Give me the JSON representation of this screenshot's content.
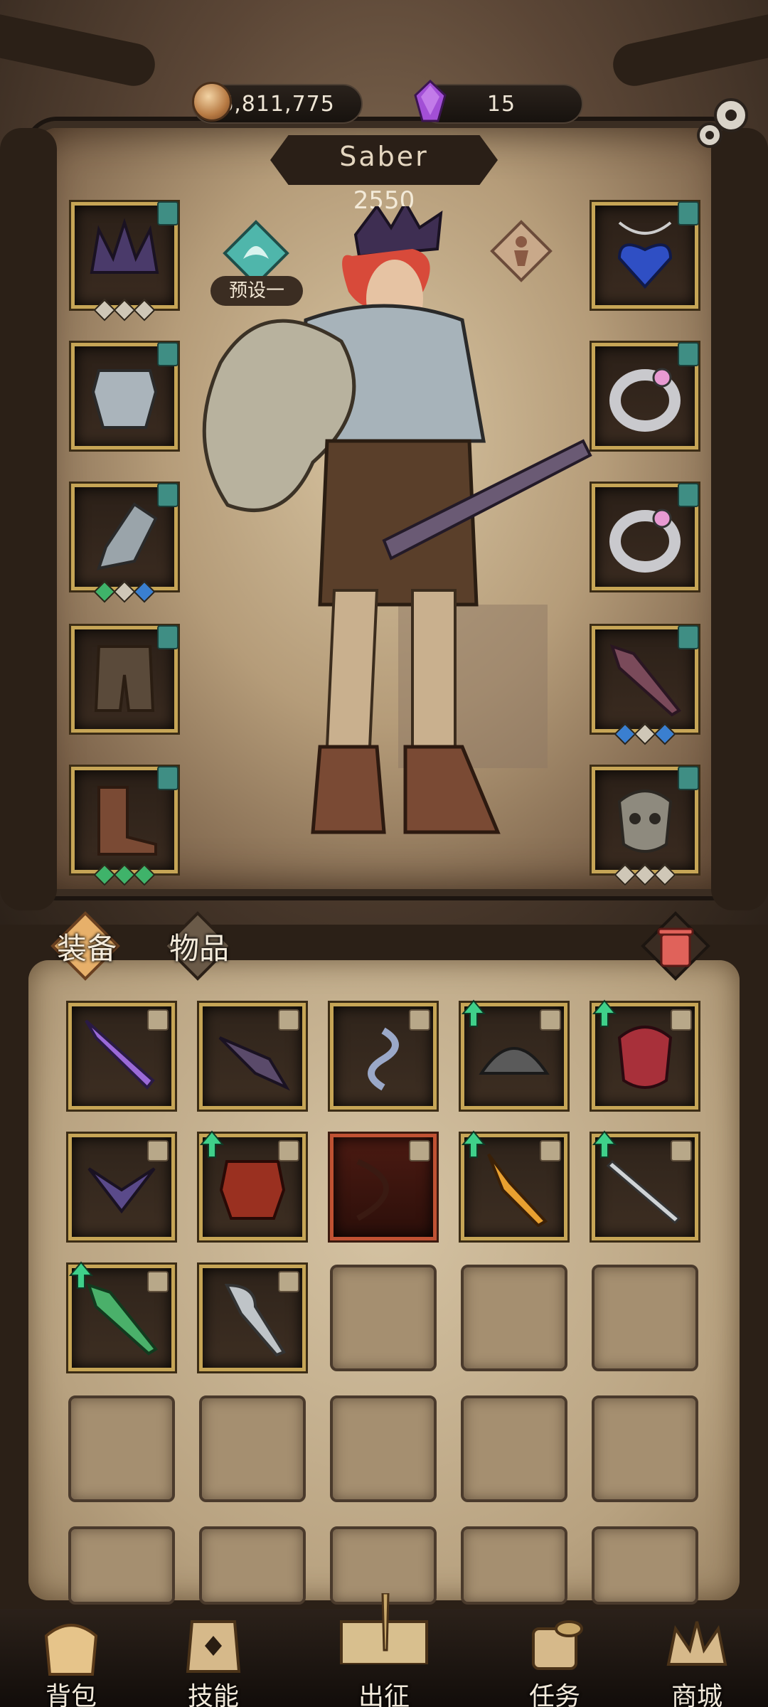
{
  "currency": {
    "gold": "6,811,775",
    "gems": "15"
  },
  "hero": {
    "name": "Saber",
    "power": "2550",
    "preset_label": "预设一"
  },
  "equipment": {
    "left_slots": [
      "crown-icon",
      "chest-armor-icon",
      "gauntlet-icon",
      "pants-icon",
      "boots-icon"
    ],
    "right_slots": [
      "heart-necklace-icon",
      "ring-icon",
      "ring-icon",
      "spiked-club-icon",
      "skull-shield-icon"
    ]
  },
  "inventory": {
    "tabs": [
      {
        "label": "装备"
      },
      {
        "label": "物品"
      }
    ],
    "items": [
      "purple-dagger-icon",
      "dark-blade-icon",
      "serpent-amulet-icon",
      "feathered-hat-icon",
      "red-mask-icon",
      "winged-crown-icon",
      "red-armor-icon",
      "dark-bow-icon",
      "flame-axe-icon",
      "rapier-icon",
      "green-sword-icon",
      "hook-blade-icon"
    ]
  },
  "colors": {
    "slot_border": "#c6a556",
    "tag_teal": "#3f8e84",
    "upgrade_green": "#3fd08a",
    "red_slot": "#c05233"
  },
  "nav": {
    "items": [
      {
        "label": "背包"
      },
      {
        "label": "技能"
      },
      {
        "label": "出征"
      },
      {
        "label": "任务"
      },
      {
        "label": "商城"
      }
    ]
  }
}
